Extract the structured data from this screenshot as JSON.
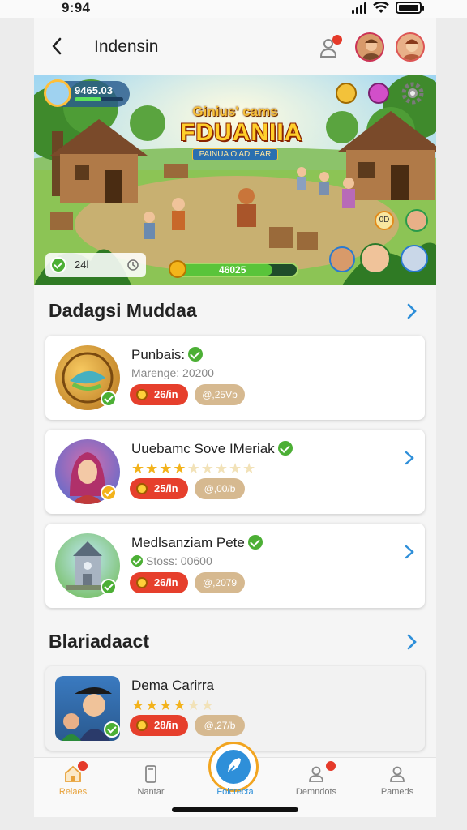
{
  "status_bar": {
    "time": "9:94"
  },
  "header": {
    "title": "Indensin"
  },
  "banner": {
    "subtitle": "Ginius' cams",
    "title": "FDUANIIA",
    "tagline": "PAINUA O ADLEAR",
    "player_score": "9465.03",
    "player_progress": 0.55,
    "counter_value": "24l",
    "energy_value": "46025",
    "energy_progress": 0.8,
    "score_bubble": "0D"
  },
  "sections": [
    {
      "title": "Dadagsi Muddaa"
    },
    {
      "title": "Blariadaact"
    }
  ],
  "cards": [
    {
      "title": "Punbais:",
      "subtitle": "Marenge: 20200",
      "chip_red": "26/in",
      "chip_tan": "@,25Vb"
    },
    {
      "title": "Uuebamc Sove IMeriak",
      "rating": 4,
      "rating_max": 9,
      "chip_red": "25/in",
      "chip_tan": "@,00/b"
    },
    {
      "title": "Medlsanziam Pete",
      "subtitle": "Stoss: 00600",
      "chip_red": "26/in",
      "chip_tan": "@,2079"
    },
    {
      "title": "Dema Carirra",
      "rating": 4,
      "rating_max": 6,
      "chip_red": "28/in",
      "chip_tan": "@,27/b"
    }
  ],
  "bottom_nav": [
    {
      "label": "Relaes",
      "icon": "home-icon"
    },
    {
      "label": "Nantar",
      "icon": "phone-icon"
    },
    {
      "label": "Folcrecta",
      "icon": "feather-icon"
    },
    {
      "label": "Demndots",
      "icon": "user-icon"
    },
    {
      "label": "Pameds",
      "icon": "profile-icon"
    }
  ],
  "colors": {
    "accent": "#2e8fd9",
    "chip_red": "#e63f2c",
    "chip_tan": "#d6b990",
    "check": "#4caf35",
    "star": "#f3b21a"
  }
}
